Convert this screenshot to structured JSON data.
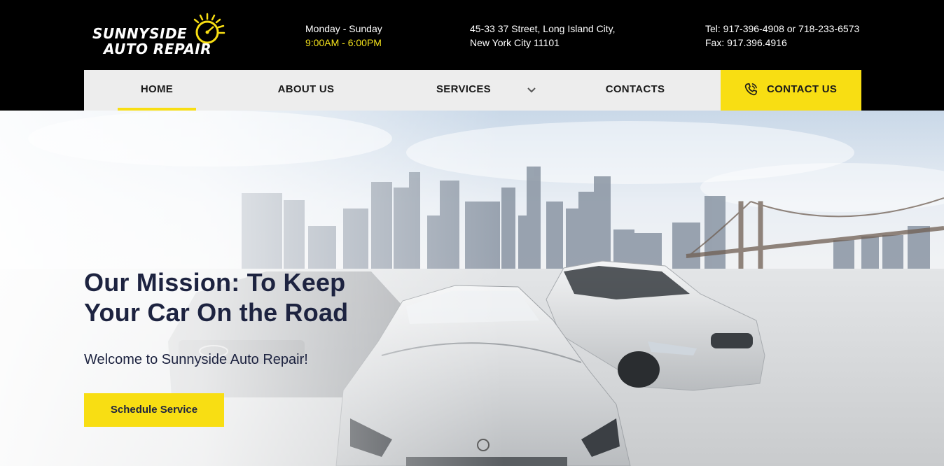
{
  "brand": {
    "line1": "Sunnyside",
    "line2": "Auto Repair",
    "accent": "#f8de13",
    "dark": "#000000",
    "text_dark": "#1d2340"
  },
  "header": {
    "hours_days": "Monday - Sunday",
    "hours_time": "9:00AM - 6:00PM",
    "address_line1": "45-33 37 Street, Long Island City,",
    "address_line2": "New York City 11101",
    "phone": "Tel: 917-396-4908 or 718-233-6573",
    "fax": "Fax: 917.396.4916"
  },
  "nav": {
    "home": "HOME",
    "about": "ABOUT US",
    "services": "SERVICES",
    "contacts": "CONTACTS",
    "cta": "CONTACT US",
    "active": "HOME"
  },
  "hero": {
    "title": "Our Mission: To Keep Your Car On the Road",
    "subtitle": "Welcome to Sunnyside Auto Repair!",
    "button": "Schedule Service"
  },
  "icons": {
    "logo": "sun-speedometer-icon",
    "services_dropdown": "chevron-down-icon",
    "cta": "phone-icon"
  }
}
